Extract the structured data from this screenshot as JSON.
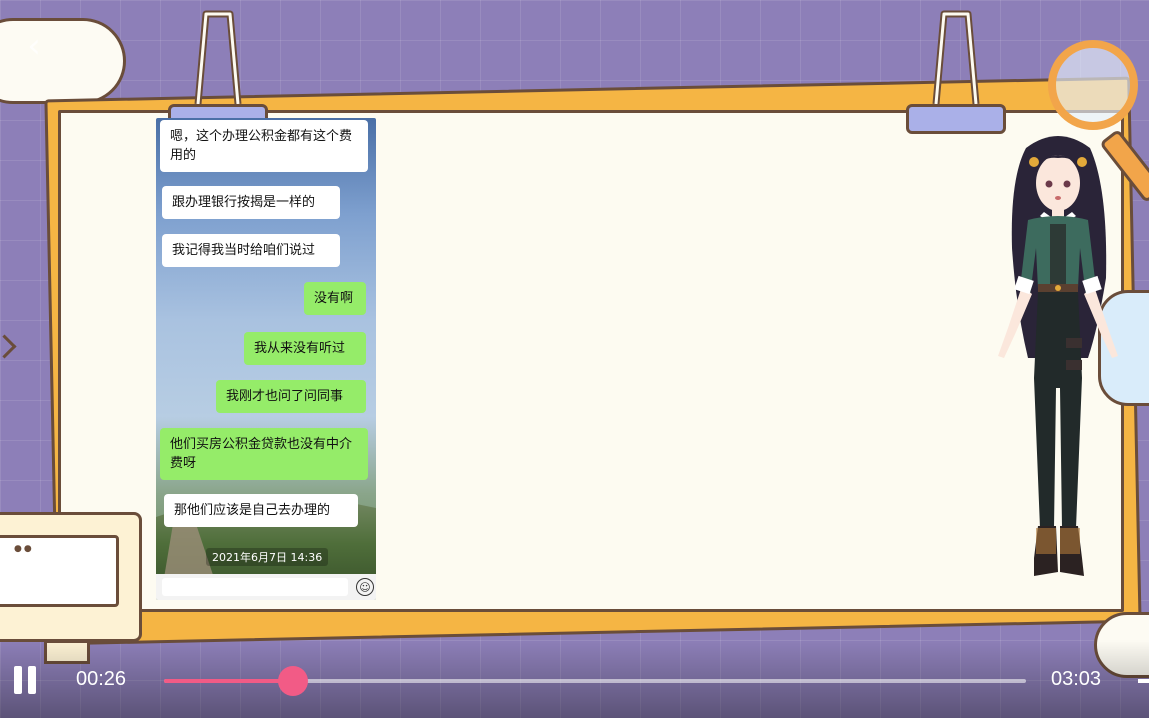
{
  "player": {
    "current_time": "00:26",
    "total_time": "03:03",
    "progress_fraction": 0.15,
    "accent_color": "#f25b86"
  },
  "chat": {
    "messages": [
      {
        "side": "left",
        "text": "嗯，这个办理公积金都有这个费用的"
      },
      {
        "side": "left",
        "text": "跟办理银行按揭是一样的"
      },
      {
        "side": "left",
        "text": "我记得我当时给咱们说过"
      },
      {
        "side": "right",
        "text": "没有啊"
      },
      {
        "side": "right",
        "text": "我从来没有听过"
      },
      {
        "side": "right",
        "text": "我刚才也问了问同事"
      },
      {
        "side": "left",
        "text": "他们买房公积金贷款也没有中介费呀"
      },
      {
        "side": "left",
        "text": "那他们应该是自己去办理的"
      }
    ],
    "timestamp": "2021年6月7日 14:36",
    "bubble_colors": {
      "left": "#ffffff",
      "right": "#95ec69"
    }
  },
  "icons": {
    "back": "back-chevron-icon",
    "pause": "pause-icon",
    "emoji": "emoji-icon"
  },
  "colors": {
    "background": "#8d7fb8",
    "board": "#fdfbf1",
    "board_shadow": "#f5b544"
  }
}
